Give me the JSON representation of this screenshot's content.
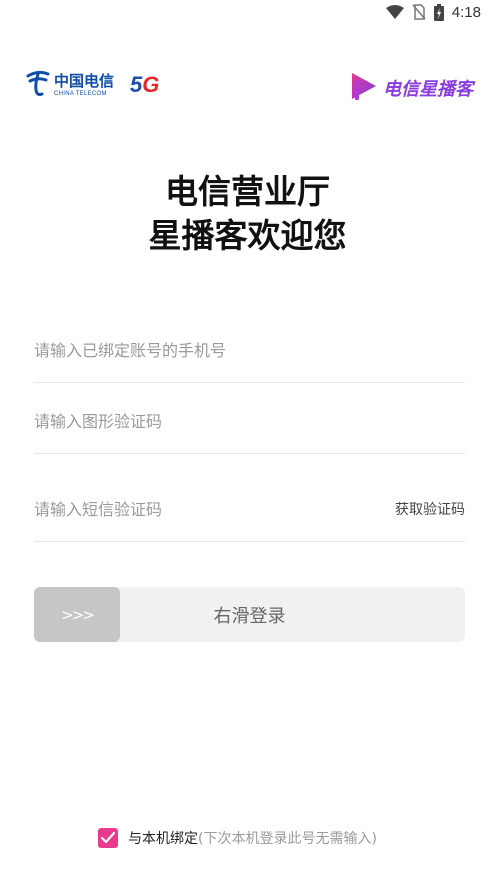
{
  "status_bar": {
    "time": "4:18",
    "icons": [
      "wifi-icon",
      "no-sim-icon",
      "battery-charging-icon"
    ]
  },
  "brand": {
    "telecom_name_cn": "中国电信",
    "telecom_name_en": "CHINA TELECOM",
    "network_badge_5": "5",
    "network_badge_g": "G",
    "app_logo_text": "电信星播客",
    "app_logo_icon": "play-logo-icon"
  },
  "welcome": {
    "line1": "电信营业厅",
    "line2": "星播客欢迎您"
  },
  "form": {
    "phone_placeholder": "请输入已绑定账号的手机号",
    "captcha_placeholder": "请输入图形验证码",
    "sms_placeholder": "请输入短信验证码",
    "get_code_label": "获取验证码"
  },
  "slider": {
    "handle_glyph": ">>>",
    "label": "右滑登录"
  },
  "bind": {
    "checked": true,
    "label": "与本机绑定",
    "hint": "(下次本机登录此号无需输入)"
  },
  "colors": {
    "telecom_blue": "#0f4ea8",
    "accent_pink": "#e83a8e",
    "accent_purple": "#8a3ee0",
    "slider_bg": "#f1f1f3",
    "slider_handle": "#c6c6c9"
  }
}
